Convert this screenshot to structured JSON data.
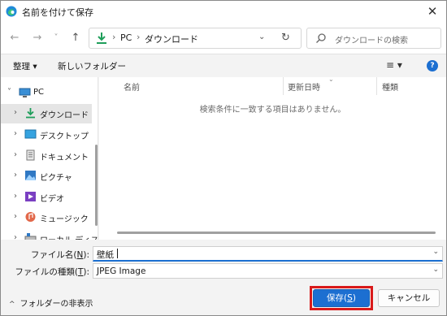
{
  "window": {
    "title": "名前を付けて保存",
    "close_glyph": "✕"
  },
  "nav": {
    "back_glyph": "←",
    "forward_glyph": "→",
    "recent_glyph": "˅",
    "up_glyph": "↑",
    "breadcrumb": [
      "PC",
      "ダウンロード"
    ],
    "breadcrumb_sep": "›",
    "dropdown_glyph": "⌄",
    "refresh_glyph": "↻",
    "search_placeholder": "ダウンロードの検索"
  },
  "commandbar": {
    "organize_label": "整理 ▾",
    "new_folder_label": "新しいフォルダー",
    "view_glyph": "≡ ▾",
    "help_glyph": "?"
  },
  "sidebar": {
    "items": [
      {
        "label": "PC",
        "arrow": "˅",
        "icon": "pc-icon"
      },
      {
        "label": "ダウンロード",
        "arrow": "›",
        "icon": "download-icon"
      },
      {
        "label": "デスクトップ",
        "arrow": "›",
        "icon": "desktop-icon"
      },
      {
        "label": "ドキュメント",
        "arrow": "›",
        "icon": "document-icon"
      },
      {
        "label": "ピクチャ",
        "arrow": "›",
        "icon": "picture-icon"
      },
      {
        "label": "ビデオ",
        "arrow": "›",
        "icon": "video-icon"
      },
      {
        "label": "ミュージック",
        "arrow": "›",
        "icon": "music-icon"
      },
      {
        "label": "ローカル ディスク (C:)",
        "arrow": "›",
        "icon": "disk-icon"
      }
    ]
  },
  "filelist": {
    "columns": [
      "名前",
      "更新日時",
      "種類"
    ],
    "sort_glyph": "⌄",
    "empty_message": "検索条件に一致する項目はありません。"
  },
  "form": {
    "filename_label": "ファイル名(",
    "filename_key": "N",
    "filename_label_end": "):",
    "filename_value": "壁紙",
    "filetype_label": "ファイルの種類(",
    "filetype_key": "T",
    "filetype_label_end": "):",
    "filetype_value": "JPEG Image",
    "combo_glyph": "⌄"
  },
  "footer": {
    "hide_folders_chevron": "^",
    "hide_folders_label": "フォルダーの非表示",
    "save_label": "保存(",
    "save_key": "S",
    "save_label_end": ")",
    "cancel_label": "キャンセル"
  },
  "colors": {
    "accent": "#1c6fd1",
    "highlight_border": "#d91a1a"
  }
}
